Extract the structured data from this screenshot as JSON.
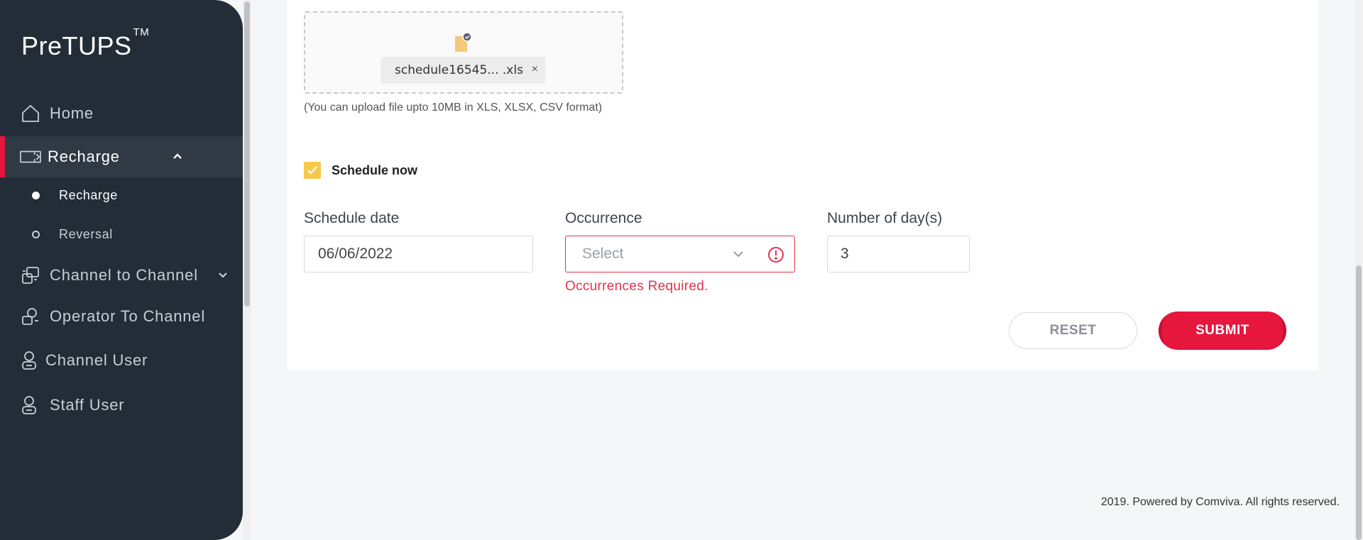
{
  "brand": {
    "name": "PreTUPS",
    "tm": "TM"
  },
  "sidebar": {
    "items": [
      {
        "label": "Home",
        "icon": "home-icon"
      },
      {
        "label": "Recharge",
        "icon": "ticket-icon",
        "active": true,
        "expanded": true,
        "children": [
          {
            "label": "Recharge",
            "active": true
          },
          {
            "label": "Reversal",
            "active": false
          }
        ]
      },
      {
        "label": "Channel to Channel",
        "icon": "channel-transfer-icon",
        "expandable": true
      },
      {
        "label": "Operator To Channel",
        "icon": "operator-channel-icon"
      },
      {
        "label": "Channel User",
        "icon": "user-icon"
      },
      {
        "label": "Staff User",
        "icon": "user-icon"
      }
    ]
  },
  "upload": {
    "file_name": "schedule16545... .xls",
    "remove_symbol": "×",
    "hint": "(You can upload file upto 10MB in XLS, XLSX, CSV format)"
  },
  "schedule": {
    "checkbox_label": "Schedule now",
    "checked": true
  },
  "form": {
    "schedule_date": {
      "label": "Schedule date",
      "value": "06/06/2022"
    },
    "occurrence": {
      "label": "Occurrence",
      "placeholder": "Select",
      "error": "Occurrences Required."
    },
    "days": {
      "label": "Number of day(s)",
      "value": "3"
    }
  },
  "buttons": {
    "reset": "RESET",
    "submit": "SUBMIT"
  },
  "footer": "2019. Powered by Comviva. All rights reserved.",
  "colors": {
    "sidebar_bg": "#222d37",
    "accent": "#e6163d",
    "checkbox": "#f7c948",
    "error": "#e5334b"
  }
}
